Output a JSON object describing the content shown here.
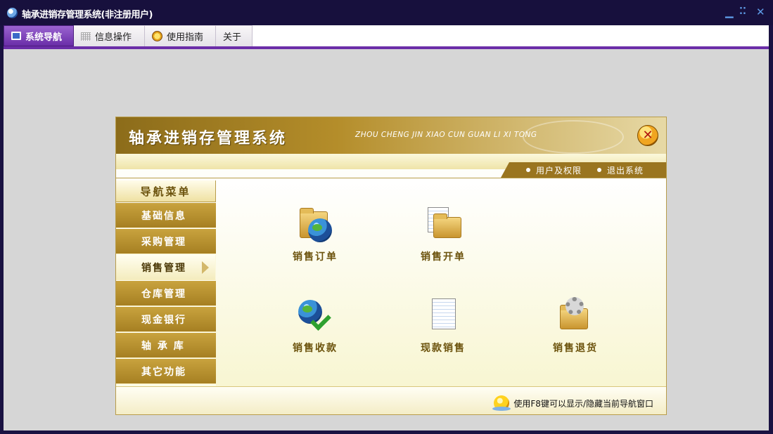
{
  "window": {
    "title": "轴承进销存管理系统(非注册用户)",
    "controls": {
      "minimize": "▁",
      "restore": "⁚⁚",
      "close": "✕"
    }
  },
  "tabs": [
    {
      "label": "系统导航",
      "icon": "monitor-icon",
      "active": true
    },
    {
      "label": "信息操作",
      "icon": "grid-icon",
      "active": false
    },
    {
      "label": "使用指南",
      "icon": "guide-icon",
      "active": false
    },
    {
      "label": "关于",
      "icon": "",
      "active": false
    }
  ],
  "panel": {
    "title": "轴承进销存管理系统",
    "subtitle": "ZHOU CHENG JIN XIAO CUN GUAN LI XI TONG",
    "close_icon": "close-icon",
    "links": [
      {
        "label": "用户及权限"
      },
      {
        "label": "退出系统"
      }
    ]
  },
  "sidebar": {
    "header": "导航菜单",
    "items": [
      {
        "label": "基础信息",
        "active": false
      },
      {
        "label": "采购管理",
        "active": false
      },
      {
        "label": "销售管理",
        "active": true
      },
      {
        "label": "仓库管理",
        "active": false
      },
      {
        "label": "现金银行",
        "active": false
      },
      {
        "label": "轴 承 库",
        "active": false
      },
      {
        "label": "其它功能",
        "active": false
      }
    ]
  },
  "functions": [
    {
      "label": "销售订单",
      "icon": "folder-globe-icon"
    },
    {
      "label": "销售开单",
      "icon": "folder-sheet-icon"
    },
    {
      "label": "销售收款",
      "icon": "globe-check-icon"
    },
    {
      "label": "现款销售",
      "icon": "document-icon"
    },
    {
      "label": "销售退货",
      "icon": "folder-gear-icon"
    }
  ],
  "footer": {
    "tip": "使用F8键可以显示/隐藏当前导航窗口",
    "tip_icon": "bulb-icon"
  },
  "colors": {
    "titlebar": "#17103d",
    "tab_active": "#6b2da8",
    "menu_gold": "#b48d2a",
    "label_brown": "#6b520c"
  }
}
